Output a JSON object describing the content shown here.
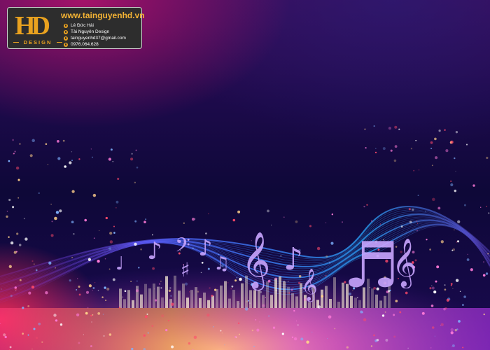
{
  "brand": {
    "logo_letters": "HD",
    "logo_tagline": "DESIGN",
    "website": "www.tainguyenhd.vn",
    "contacts": [
      {
        "icon": "facebook-icon",
        "text": "Lê Đức Hải"
      },
      {
        "icon": "youtube-icon",
        "text": "Tài Nguyên Design"
      },
      {
        "icon": "email-icon",
        "text": "tainguyenhd37@gmail.com"
      },
      {
        "icon": "phone-icon",
        "text": "0976.064.628"
      }
    ]
  },
  "artwork": {
    "notes": [
      "♪",
      "♫",
      "𝄢",
      "𝄞",
      "♩",
      "♯",
      "♬"
    ],
    "colors": {
      "background_top": "#3a0c5a",
      "background_mid": "#0e0838",
      "glow_magenta": "#c8146e",
      "wave_blue": "#4a6bff",
      "glow_orange": "#ffb347",
      "note_color": "#c9a6ff",
      "logo_gold": "#e9a21f",
      "logo_panel": "#2d2d2d"
    }
  }
}
